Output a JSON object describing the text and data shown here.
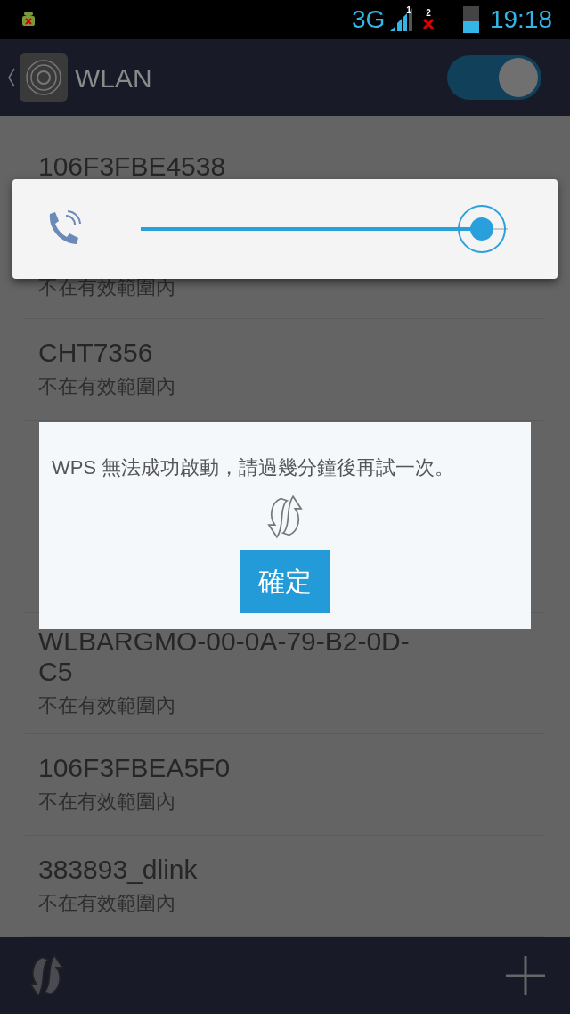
{
  "status_bar": {
    "network": "3G",
    "sim_1": "1",
    "sim_2": "2",
    "time": "19:18",
    "battery": {
      "level": 0.45
    }
  },
  "header": {
    "title": "WLAN",
    "wifi_switch": {
      "on": true
    }
  },
  "networks_top": [
    {
      "name": "106F3FBE4538"
    },
    {
      "subtitle": "不在有效範圍內"
    },
    {
      "name": "CHT7356",
      "subtitle": "不在有效範圍內"
    }
  ],
  "networks_bottom": [
    {
      "name": "WLBARGMO-00-0A-79-B2-0D-C5",
      "subtitle": "不在有效範圍內"
    },
    {
      "name": "106F3FBEA5F0",
      "subtitle": "不在有效範圍內"
    },
    {
      "name": "383893_dlink",
      "subtitle": "不在有效範圍內"
    }
  ],
  "volume_panel": {
    "level": 0.93
  },
  "dialog": {
    "message": "WPS 無法成功啟動，請過幾分鐘後再試一次。",
    "button": "確定"
  }
}
